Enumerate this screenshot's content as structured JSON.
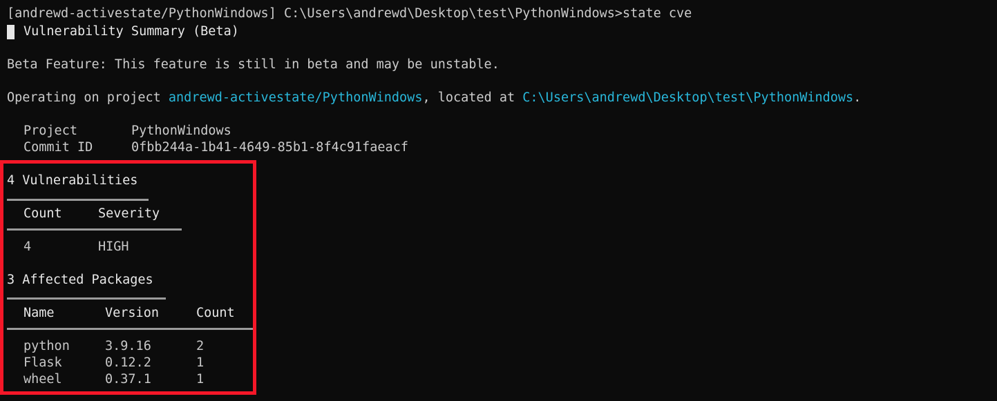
{
  "terminal": {
    "background_color": "#0c0c0c",
    "foreground_color": "#cccccc",
    "accent_color": "#29b8db",
    "highlight_color": "#f51728",
    "rule_color": "#9b9b9b",
    "cursor": "block"
  },
  "prompt": {
    "project_tag": "[andrewd-activestate/PythonWindows]",
    "cwd": "C:\\Users\\andrewd\\Desktop\\test\\PythonWindows>",
    "command": "state cve",
    "full_line": "[andrewd-activestate/PythonWindows] C:\\Users\\andrewd\\Desktop\\test\\PythonWindows>state cve"
  },
  "header": {
    "title": "Vulnerability Summary (Beta)"
  },
  "notice": {
    "beta_text": "Beta Feature: This feature is still in beta and may be unstable."
  },
  "operating": {
    "prefix": "Operating on project ",
    "project": "andrewd-activestate/PythonWindows",
    "middle": ", located at ",
    "path": "C:\\Users\\andrewd\\Desktop\\test\\PythonWindows",
    "suffix": "."
  },
  "meta": {
    "rows": [
      {
        "label": "Project",
        "value": "PythonWindows"
      },
      {
        "label": "Commit ID",
        "value": "0fbb244a-1b41-4649-85b1-8f4c91faeacf"
      }
    ]
  },
  "vulnerabilities": {
    "title": "4 Vulnerabilities",
    "count": 4,
    "columns": [
      "Count",
      "Severity"
    ],
    "rows": [
      {
        "count": "4",
        "severity": "HIGH"
      }
    ]
  },
  "affected_packages": {
    "title": "3 Affected Packages",
    "count": 3,
    "columns": [
      "Name",
      "Version",
      "Count"
    ],
    "rows": [
      {
        "name": "python",
        "version": "3.9.16",
        "count": "2"
      },
      {
        "name": "Flask",
        "version": "0.12.2",
        "count": "1"
      },
      {
        "name": "wheel",
        "version": "0.37.1",
        "count": "1"
      }
    ]
  }
}
